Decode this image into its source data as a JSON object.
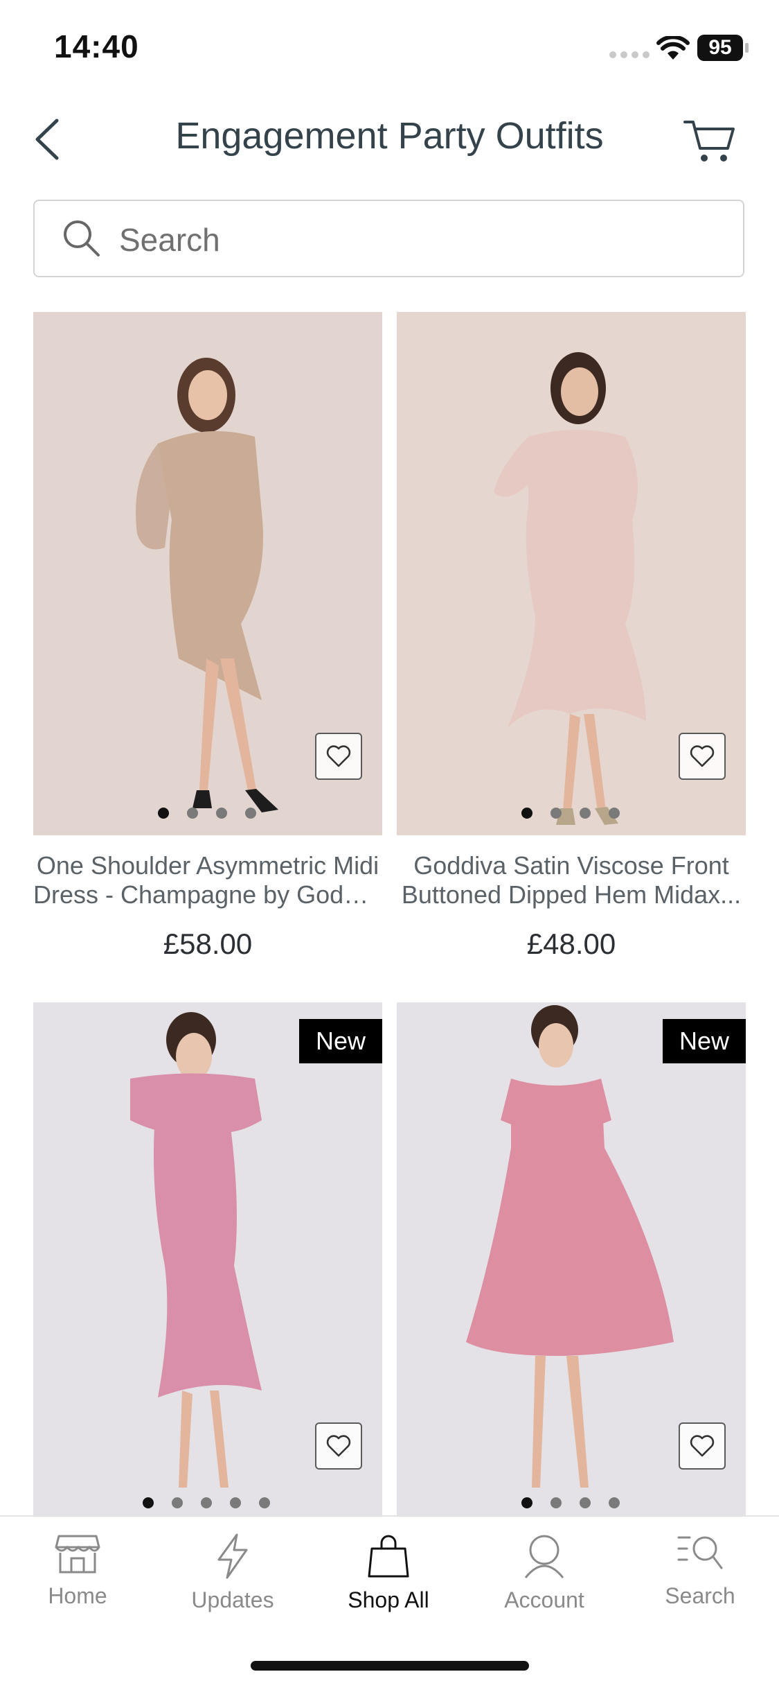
{
  "status_bar": {
    "time": "14:40",
    "battery": "95"
  },
  "header": {
    "title": "Engagement Party Outfits"
  },
  "search": {
    "placeholder": "Search"
  },
  "products": [
    {
      "name_line1": "One Shoulder Asymmetric Midi",
      "name_line2": "Dress - Champagne by Goddiva",
      "price": "£58.00",
      "badge": "",
      "image_pages": 4,
      "image_active_page": 1,
      "image_bg": "#e2d4cf",
      "dress_color": "#c9ab96"
    },
    {
      "name_line1": "Goddiva Satin Viscose Front",
      "name_line2": "Buttoned Dipped Hem Midax...",
      "price": "£48.00",
      "badge": "",
      "image_pages": 4,
      "image_active_page": 1,
      "image_bg": "#e6d6d0",
      "dress_color": "#e6c9c2"
    },
    {
      "badge": "New",
      "image_pages": 5,
      "image_active_page": 1,
      "image_bg": "#e4e2e6",
      "dress_color": "#d98eaa"
    },
    {
      "badge": "New",
      "image_pages": 4,
      "image_active_page": 1,
      "image_bg": "#e4e2e6",
      "dress_color": "#dd8ea1"
    }
  ],
  "tabs": [
    {
      "label": "Home",
      "icon": "store-icon",
      "active": false
    },
    {
      "label": "Updates",
      "icon": "lightning-icon",
      "active": false
    },
    {
      "label": "Shop All",
      "icon": "shopping-bag-icon",
      "active": true
    },
    {
      "label": "Account",
      "icon": "user-icon",
      "active": false
    },
    {
      "label": "Search",
      "icon": "search-list-icon",
      "active": false
    }
  ]
}
